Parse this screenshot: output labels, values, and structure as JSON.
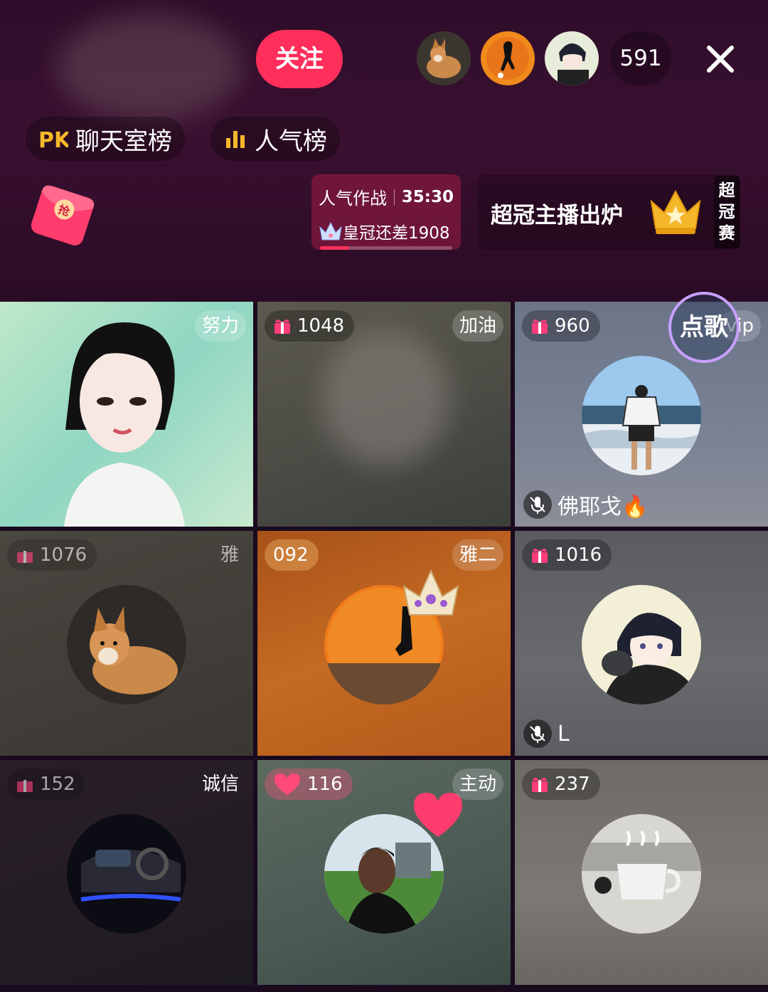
{
  "header": {
    "follow_label": "关注",
    "viewer_count": "591"
  },
  "rank_links": {
    "chatroom_label": "聊天室榜",
    "popularity_label": "人气榜"
  },
  "battle": {
    "title": "人气作战",
    "timer": "35:30",
    "status": "皇冠还差1908",
    "progress": 0.22
  },
  "champion": {
    "title": "超冠主播出炉",
    "tag": [
      "超",
      "冠",
      "赛"
    ]
  },
  "song_button_label": "点歌",
  "seats": [
    {
      "gift": "",
      "tag": "努力",
      "name": "",
      "theme": "avatar3d"
    },
    {
      "gift": "1048",
      "tag": "加油",
      "name": "",
      "theme": "empty"
    },
    {
      "gift": "960",
      "tag": "vip",
      "name": "佛耶戈🔥",
      "theme": "beach"
    },
    {
      "gift": "1076",
      "tag": "雅",
      "name": "",
      "theme": "dog"
    },
    {
      "gift": "092",
      "tag": "雅二",
      "name": "",
      "theme": "sunset"
    },
    {
      "gift": "1016",
      "tag": "",
      "name": "L",
      "theme": "anime"
    },
    {
      "gift": "152",
      "tag": "诚信",
      "name": "",
      "theme": "car"
    },
    {
      "gift": "116",
      "tag": "主动",
      "name": "",
      "theme": "person"
    },
    {
      "gift": "237",
      "tag": "",
      "name": "",
      "theme": "cafe"
    }
  ],
  "colors": {
    "accent_pink": "#ff2e5a",
    "gift_pink": "#ff3c7a",
    "crown_gold": "#f5b72a"
  },
  "icons": {
    "close": "close-icon",
    "mic_off": "mic-off-icon",
    "gift": "gift-icon",
    "heart": "heart-icon",
    "crown": "crown-icon",
    "red_packet": "red-packet-icon"
  }
}
